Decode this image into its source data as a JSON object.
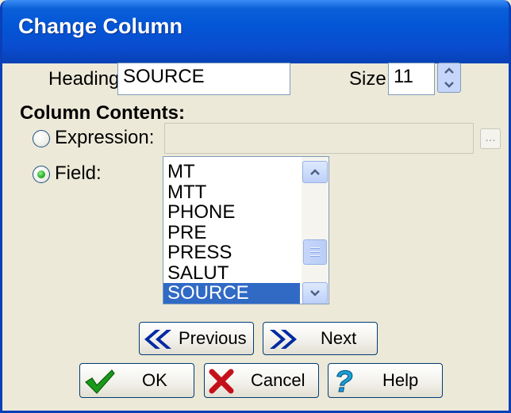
{
  "window": {
    "title": "Change Column"
  },
  "heading": {
    "label": "Heading:",
    "value": "SOURCE"
  },
  "size": {
    "label": "Size:",
    "value": "11"
  },
  "section": {
    "label": "Column Contents:"
  },
  "expression": {
    "label": "Expression:",
    "selected": false,
    "browse_label": "..."
  },
  "field": {
    "label": "Field:",
    "selected": true,
    "items": [
      "MT",
      "MTT",
      "PHONE",
      "PRE",
      "PRESS",
      "SALUT",
      "SOURCE"
    ],
    "selected_item": "SOURCE"
  },
  "nav": {
    "previous_label": "Previous",
    "next_label": "Next"
  },
  "actions": {
    "ok_label": "OK",
    "cancel_label": "Cancel",
    "help_label": "Help"
  },
  "colors": {
    "accent": "#316ac5",
    "titlebar": "#0a5fd8",
    "face": "#ece9d8"
  }
}
